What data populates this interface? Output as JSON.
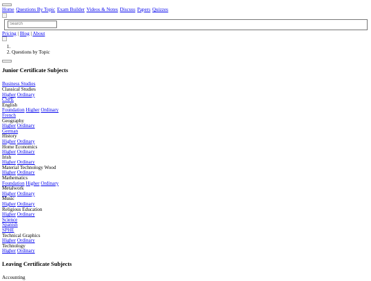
{
  "menu_button": {
    "label": ""
  },
  "nav": [
    {
      "label": "Home"
    },
    {
      "label": "Questions By Topic"
    },
    {
      "label": "Exam Builder"
    },
    {
      "label": "Videos & Notes"
    },
    {
      "label": "Discuss"
    },
    {
      "label": "Papers"
    },
    {
      "label": "Quizzes"
    }
  ],
  "search": {
    "placeholder": "Search",
    "value": ""
  },
  "secondary_links": [
    {
      "label": "Pricing"
    },
    {
      "label": "Blog"
    },
    {
      "label": "About"
    }
  ],
  "separator": "|",
  "breadcrumb": [
    {
      "number": "1.",
      "label": ""
    },
    {
      "number": "2.",
      "label": "Questions by Topic"
    }
  ],
  "sections": [
    {
      "title": "Junior Certificate Subjects",
      "subjects": [
        {
          "name": "Business Studies",
          "link": true,
          "levels": []
        },
        {
          "name": "Classical Studies",
          "link": false,
          "levels": [
            "Higher",
            "Ordinary"
          ]
        },
        {
          "name": "CSPE",
          "link": true,
          "levels": []
        },
        {
          "name": "English",
          "link": false,
          "levels": [
            "Foundation",
            "Higher",
            "Ordinary"
          ]
        },
        {
          "name": "French",
          "link": true,
          "levels": []
        },
        {
          "name": "Geography",
          "link": false,
          "levels": [
            "Higher",
            "Ordinary"
          ]
        },
        {
          "name": "German",
          "link": true,
          "levels": []
        },
        {
          "name": "History",
          "link": false,
          "levels": [
            "Higher",
            "Ordinary"
          ]
        },
        {
          "name": "Home Economics",
          "link": false,
          "levels": [
            "Higher",
            "Ordinary"
          ]
        },
        {
          "name": "Irish",
          "link": false,
          "levels": [
            "Higher",
            "Ordinary"
          ]
        },
        {
          "name": "Material Technology Wood",
          "link": false,
          "levels": [
            "Higher",
            "Ordinary"
          ]
        },
        {
          "name": "Mathematics",
          "link": false,
          "levels": [
            "Foundation",
            "Higher",
            "Ordinary"
          ]
        },
        {
          "name": "Metalwork",
          "link": false,
          "levels": [
            "Higher",
            "Ordinary"
          ]
        },
        {
          "name": "Music",
          "link": false,
          "levels": [
            "Higher",
            "Ordinary"
          ]
        },
        {
          "name": "Religious Education",
          "link": false,
          "levels": [
            "Higher",
            "Ordinary"
          ]
        },
        {
          "name": "Science",
          "link": true,
          "levels": []
        },
        {
          "name": "Spanish",
          "link": true,
          "levels": []
        },
        {
          "name": "SPHE",
          "link": true,
          "levels": []
        },
        {
          "name": "Technical Graphics",
          "link": false,
          "levels": [
            "Higher",
            "Ordinary"
          ]
        },
        {
          "name": "Technology",
          "link": false,
          "levels": [
            "Higher",
            "Ordinary"
          ]
        }
      ]
    },
    {
      "title": "Leaving Certificate Subjects",
      "subjects": [
        {
          "name": "Accounting",
          "link": false,
          "levels": []
        }
      ]
    }
  ],
  "colors": {
    "link": "#0000ee",
    "text": "#000000",
    "background": "#ffffff"
  }
}
